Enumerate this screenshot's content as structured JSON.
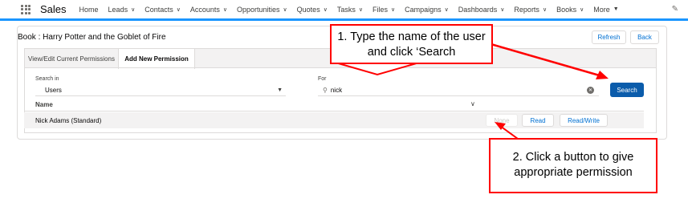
{
  "nav": {
    "app_name": "Sales",
    "items": [
      {
        "label": "Home",
        "chevron": false
      },
      {
        "label": "Leads",
        "chevron": true
      },
      {
        "label": "Contacts",
        "chevron": true
      },
      {
        "label": "Accounts",
        "chevron": true
      },
      {
        "label": "Opportunities",
        "chevron": true
      },
      {
        "label": "Quotes",
        "chevron": true
      },
      {
        "label": "Tasks",
        "chevron": true
      },
      {
        "label": "Files",
        "chevron": true
      },
      {
        "label": "Campaigns",
        "chevron": true
      },
      {
        "label": "Dashboards",
        "chevron": true
      },
      {
        "label": "Reports",
        "chevron": true
      },
      {
        "label": "Books",
        "chevron": true
      },
      {
        "label": "More",
        "chevron": true
      }
    ]
  },
  "page": {
    "title": "Book : Harry Potter and the Goblet of Fire",
    "refresh_label": "Refresh",
    "back_label": "Back"
  },
  "tabs": [
    {
      "label": "View/Edit Current Permissions",
      "active": false
    },
    {
      "label": "Add New Permission",
      "active": true
    }
  ],
  "form": {
    "search_in_label": "Search in",
    "search_in_value": "Users",
    "for_label": "For",
    "for_value": "nick",
    "search_button": "Search"
  },
  "table": {
    "header_name": "Name",
    "rows": [
      {
        "name": "Nick Adams (Standard)",
        "none": "None",
        "read": "Read",
        "readwrite": "Read/Write"
      }
    ]
  },
  "callouts": {
    "c1": "1. Type the name of the user and click ‘Search",
    "c2": "2. Click a button to give appropriate permission"
  },
  "colors": {
    "accent": "#0b5cab",
    "nav_border": "#1b96ff",
    "callout": "#ff0000"
  }
}
